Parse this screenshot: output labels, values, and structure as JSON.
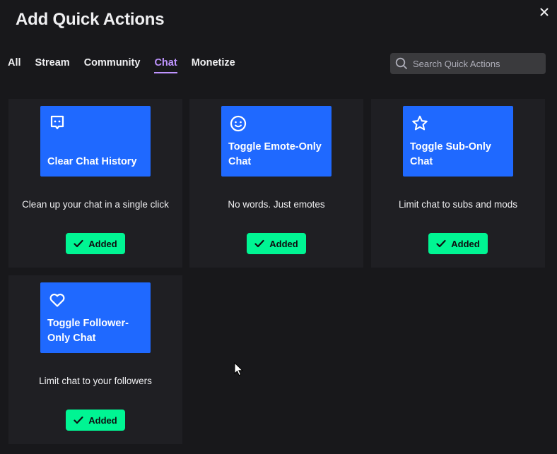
{
  "modal": {
    "title": "Add Quick Actions",
    "close_icon": "close-icon"
  },
  "tabs": [
    {
      "label": "All",
      "active": false
    },
    {
      "label": "Stream",
      "active": false
    },
    {
      "label": "Community",
      "active": false
    },
    {
      "label": "Chat",
      "active": true
    },
    {
      "label": "Monetize",
      "active": false
    }
  ],
  "search": {
    "placeholder": "Search Quick Actions",
    "value": "",
    "icon": "search-icon"
  },
  "cards": [
    {
      "title": "Clear Chat History",
      "description": "Clean up your chat in a single click",
      "icon": "chat-bubble-icon",
      "status": "Added"
    },
    {
      "title": "Toggle Emote-Only Chat",
      "description": "No words. Just emotes",
      "icon": "smiley-icon",
      "status": "Added"
    },
    {
      "title": "Toggle Sub-Only Chat",
      "description": "Limit chat to subs and mods",
      "icon": "star-icon",
      "status": "Added"
    },
    {
      "title": "Toggle Follower-Only Chat",
      "description": "Limit chat to your followers",
      "icon": "heart-icon",
      "status": "Added"
    }
  ],
  "colors": {
    "background": "#18181b",
    "card": "#1f1f23",
    "tile": "#1f69ff",
    "active_tab": "#bf94ff",
    "added_button": "#00f593"
  }
}
